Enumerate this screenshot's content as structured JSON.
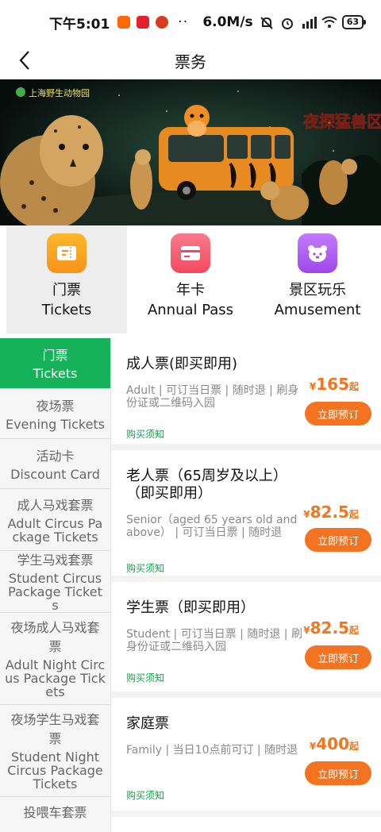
{
  "status_bar": {
    "time": "下午5:01",
    "dots": "··",
    "net_speed": "6.0M/s",
    "battery": "63"
  },
  "nav": {
    "title": "票务"
  },
  "banner": {
    "logo_text": "上海野生动物园",
    "title_text": "夜探猛兽区"
  },
  "categories": [
    {
      "zh": "门票",
      "en": "Tickets",
      "color": "#f9a11b"
    },
    {
      "zh": "年卡",
      "en": "Annual Pass",
      "color": "#f45a6c"
    },
    {
      "zh": "景区玩乐",
      "en": "Amusement",
      "color": "#b05ff2"
    }
  ],
  "sidebar": {
    "items": [
      {
        "zh": "门票",
        "en": "Tickets"
      },
      {
        "zh": "夜场票",
        "en": "Evening Tickets"
      },
      {
        "zh": "活动卡",
        "en": "Discount Card"
      },
      {
        "zh": "成人马戏套票",
        "en": "Adult Circus Package Tickets"
      },
      {
        "zh": "学生马戏套票",
        "en": "Student Circus Package Tickets"
      },
      {
        "zh": "夜场成人马戏套票",
        "en": "Adult Night Circus Package Tickets"
      },
      {
        "zh": "夜场学生马戏套票",
        "en": "Student Night Circus Package Tickets"
      },
      {
        "zh": "投喂车套票",
        "en": ""
      }
    ]
  },
  "tickets": [
    {
      "name": "成人票(即买即用)",
      "desc": "Adult | 可订当日票 | 随时退 | 刷身份证或二维码入园",
      "price": "165",
      "currency": "¥",
      "suffix": "起",
      "button": "立即预订",
      "notice": "购买须知"
    },
    {
      "name": "老人票（65周岁及以上）（即买即用）",
      "desc": "Senior（aged 65 years old and above） | 可订当日票 | 随时退",
      "price": "82.5",
      "currency": "¥",
      "suffix": "起",
      "button": "立即预订",
      "notice": "购买须知"
    },
    {
      "name": "学生票（即买即用）",
      "desc": "Student | 可订当日票 | 随时退 | 刷身份证或二维码入园",
      "price": "82.5",
      "currency": "¥",
      "suffix": "起",
      "button": "立即预订",
      "notice": "购买须知"
    },
    {
      "name": "家庭票",
      "desc": "Family | 当日10点前可订 | 随时退",
      "price": "400",
      "currency": "¥",
      "suffix": "起",
      "button": "立即预订",
      "notice": "购买须知"
    }
  ]
}
